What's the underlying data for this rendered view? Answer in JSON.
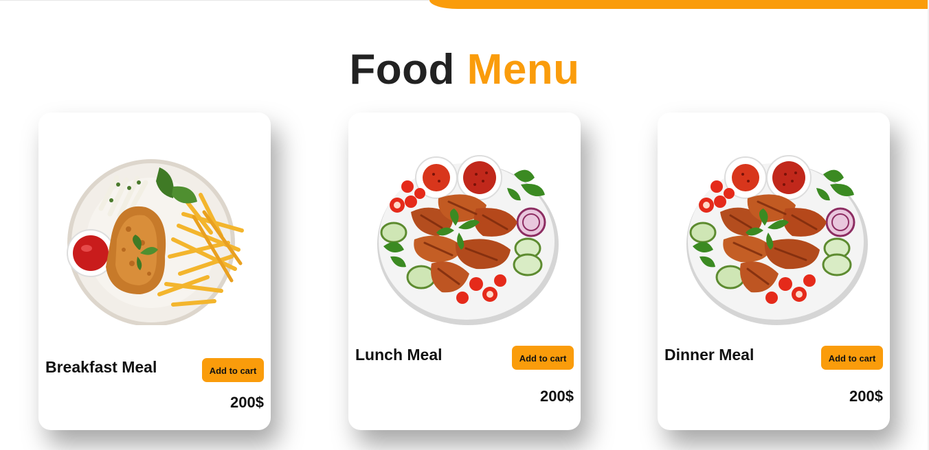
{
  "header": {
    "title_word1": "Food",
    "title_word2": "Menu",
    "accent_color": "#fa9c0b"
  },
  "menu": {
    "items": [
      {
        "name": "Breakfast Meal",
        "button_label": "Add to cart",
        "price": "200$",
        "image": "fried-chicken-fries-plate"
      },
      {
        "name": "Lunch Meal",
        "button_label": "Add to cart",
        "price": "200$",
        "image": "grilled-chicken-salad-plate"
      },
      {
        "name": "Dinner Meal",
        "button_label": "Add to cart",
        "price": "200$",
        "image": "grilled-chicken-salad-plate"
      }
    ]
  }
}
